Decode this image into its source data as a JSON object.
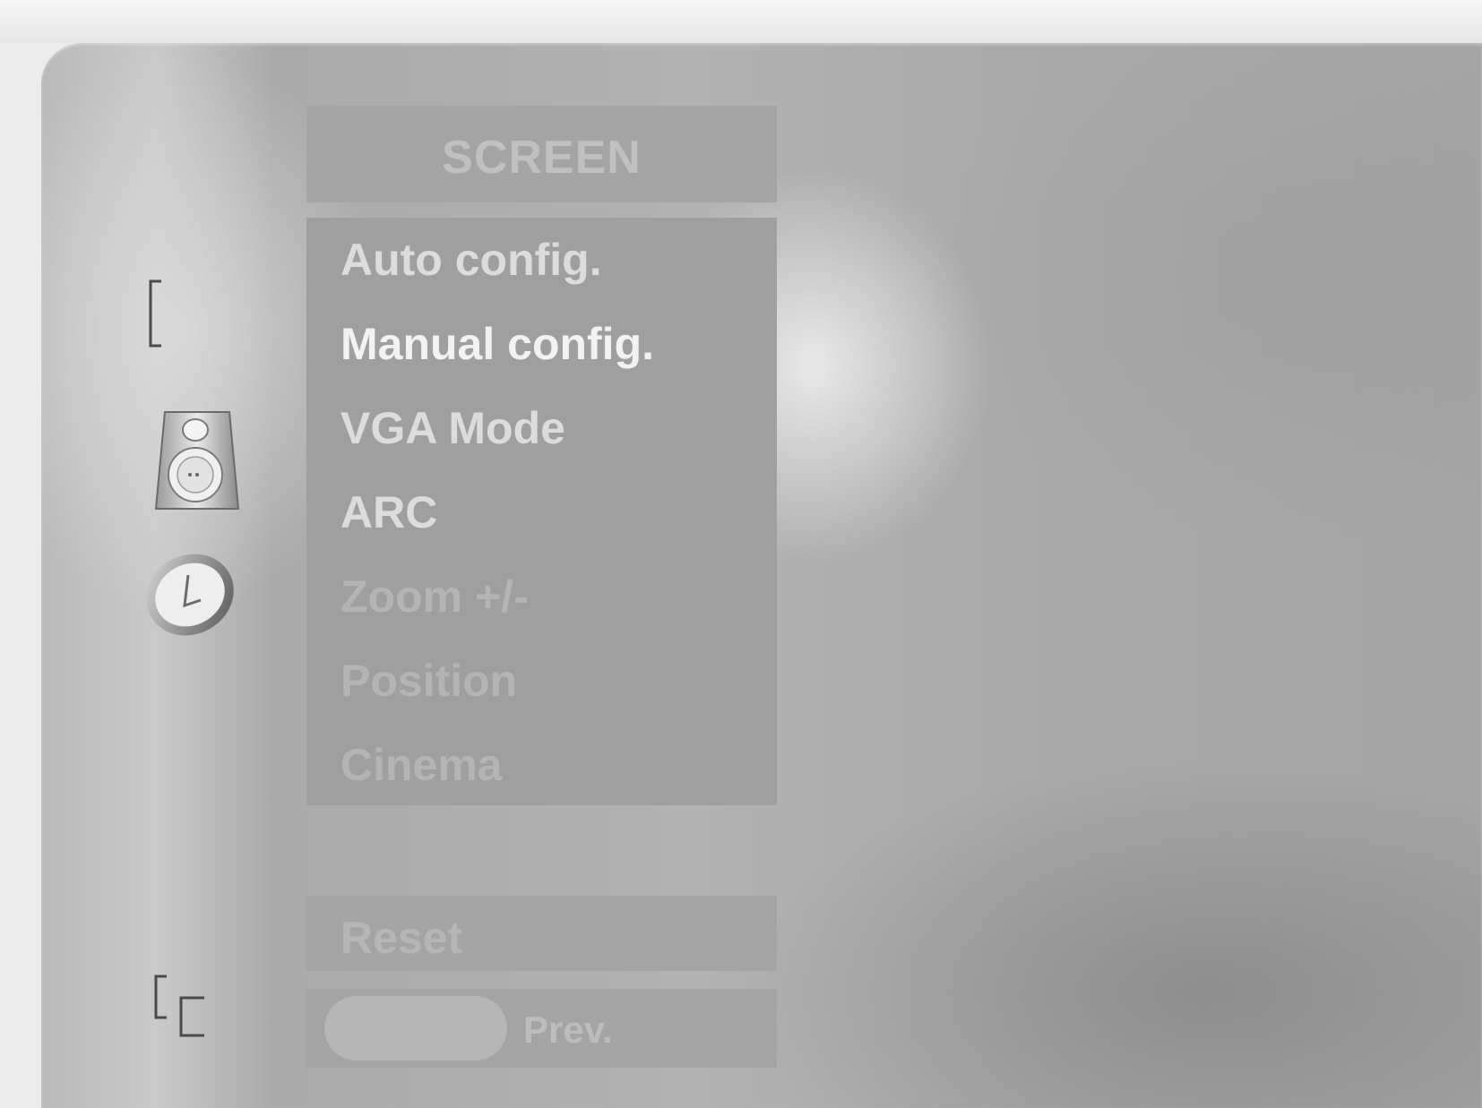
{
  "osd": {
    "title": "SCREEN",
    "items": [
      {
        "label": "Auto config.",
        "state": "active"
      },
      {
        "label": "Manual config.",
        "state": "selected"
      },
      {
        "label": "VGA Mode",
        "state": "active"
      },
      {
        "label": "ARC",
        "state": "active"
      },
      {
        "label": "Zoom +/-",
        "state": "disabled"
      },
      {
        "label": "Position",
        "state": "disabled"
      },
      {
        "label": "Cinema",
        "state": "disabled"
      }
    ],
    "reset_label": "Reset",
    "prev_label": "Prev."
  },
  "side_icons": [
    "picture-bracket-icon",
    "speaker-icon",
    "clock-icon",
    "screen-corners-icon"
  ],
  "colors": {
    "panel": "#b0b0b0",
    "menu_bg": "#9f9f9f",
    "text_active": "#dcdcdc",
    "text_selected": "#f2f2f2",
    "text_disabled": "#b4b4b4"
  }
}
